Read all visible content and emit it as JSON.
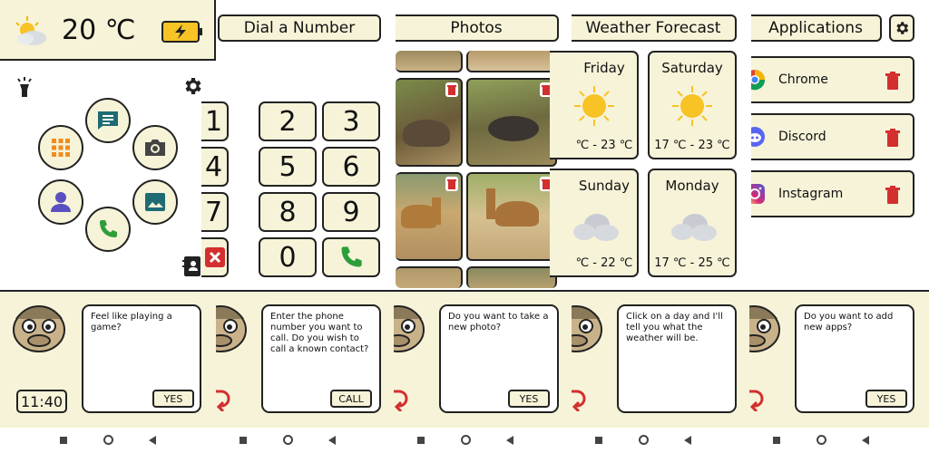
{
  "status": {
    "temperature": "20 ℃"
  },
  "home": {
    "clock": "11:40",
    "speech": "Feel like playing a game?",
    "speech_button": "YES"
  },
  "dial": {
    "title": "Dial a Number",
    "keys": [
      "1",
      "2",
      "3",
      "4",
      "5",
      "6",
      "7",
      "8",
      "9",
      "0"
    ],
    "speech": "Enter the phone number you want to call. Do you wish to call a known contact?",
    "speech_button": "CALL"
  },
  "photos": {
    "title": "Photos",
    "speech": "Do you want to take a new photo?",
    "speech_button": "YES"
  },
  "weather": {
    "title": "Weather Forecast",
    "days": [
      {
        "day": "Friday",
        "temp": "℃ - 23 ℃",
        "icon": "sun-icon"
      },
      {
        "day": "Saturday",
        "temp": "17 ℃ - 23 ℃",
        "icon": "sun-icon"
      },
      {
        "day": "Sunday",
        "temp": "℃ - 22 ℃",
        "icon": "cloud-icon"
      },
      {
        "day": "Monday",
        "temp": "17 ℃ - 25 ℃",
        "icon": "cloud-icon"
      }
    ],
    "speech": "Click on a day and I'll tell you what the weather will be."
  },
  "apps": {
    "title": "Applications",
    "items": [
      {
        "name": "Chrome",
        "icon": "chrome-icon"
      },
      {
        "name": "Discord",
        "icon": "discord-icon"
      },
      {
        "name": "Instagram",
        "icon": "instagram-icon"
      }
    ],
    "speech": "Do you want to add new apps?",
    "speech_button": "YES"
  },
  "colors": {
    "cream": "#f6f3d8",
    "teal": "#1e6b73",
    "delete": "#d32f2f",
    "call": "#2e9e3a",
    "grid": "#f08c1e",
    "user": "#5a4fc0"
  }
}
